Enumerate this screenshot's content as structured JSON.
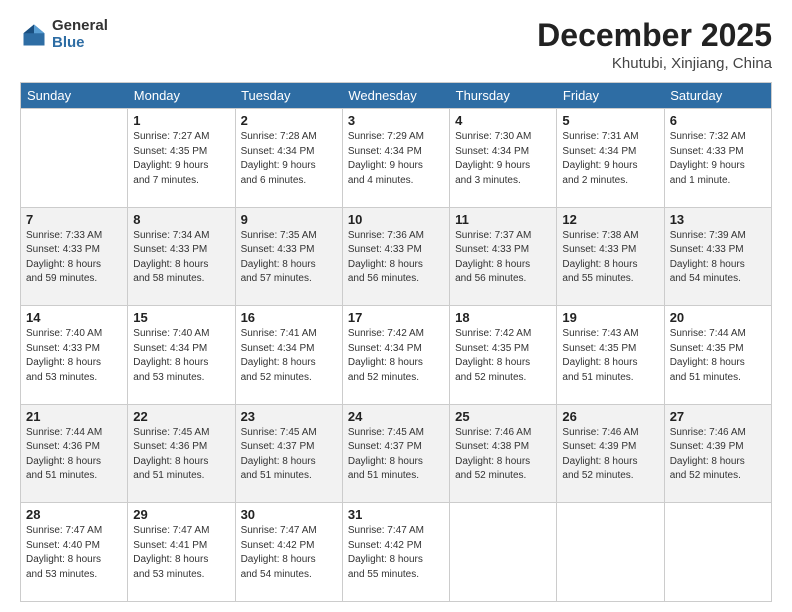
{
  "logo": {
    "general": "General",
    "blue": "Blue"
  },
  "title": {
    "month": "December 2025",
    "location": "Khutubi, Xinjiang, China"
  },
  "days_of_week": [
    "Sunday",
    "Monday",
    "Tuesday",
    "Wednesday",
    "Thursday",
    "Friday",
    "Saturday"
  ],
  "weeks": [
    [
      {
        "day": "",
        "info": ""
      },
      {
        "day": "1",
        "info": "Sunrise: 7:27 AM\nSunset: 4:35 PM\nDaylight: 9 hours\nand 7 minutes."
      },
      {
        "day": "2",
        "info": "Sunrise: 7:28 AM\nSunset: 4:34 PM\nDaylight: 9 hours\nand 6 minutes."
      },
      {
        "day": "3",
        "info": "Sunrise: 7:29 AM\nSunset: 4:34 PM\nDaylight: 9 hours\nand 4 minutes."
      },
      {
        "day": "4",
        "info": "Sunrise: 7:30 AM\nSunset: 4:34 PM\nDaylight: 9 hours\nand 3 minutes."
      },
      {
        "day": "5",
        "info": "Sunrise: 7:31 AM\nSunset: 4:34 PM\nDaylight: 9 hours\nand 2 minutes."
      },
      {
        "day": "6",
        "info": "Sunrise: 7:32 AM\nSunset: 4:33 PM\nDaylight: 9 hours\nand 1 minute."
      }
    ],
    [
      {
        "day": "7",
        "info": "Sunrise: 7:33 AM\nSunset: 4:33 PM\nDaylight: 8 hours\nand 59 minutes."
      },
      {
        "day": "8",
        "info": "Sunrise: 7:34 AM\nSunset: 4:33 PM\nDaylight: 8 hours\nand 58 minutes."
      },
      {
        "day": "9",
        "info": "Sunrise: 7:35 AM\nSunset: 4:33 PM\nDaylight: 8 hours\nand 57 minutes."
      },
      {
        "day": "10",
        "info": "Sunrise: 7:36 AM\nSunset: 4:33 PM\nDaylight: 8 hours\nand 56 minutes."
      },
      {
        "day": "11",
        "info": "Sunrise: 7:37 AM\nSunset: 4:33 PM\nDaylight: 8 hours\nand 56 minutes."
      },
      {
        "day": "12",
        "info": "Sunrise: 7:38 AM\nSunset: 4:33 PM\nDaylight: 8 hours\nand 55 minutes."
      },
      {
        "day": "13",
        "info": "Sunrise: 7:39 AM\nSunset: 4:33 PM\nDaylight: 8 hours\nand 54 minutes."
      }
    ],
    [
      {
        "day": "14",
        "info": "Sunrise: 7:40 AM\nSunset: 4:33 PM\nDaylight: 8 hours\nand 53 minutes."
      },
      {
        "day": "15",
        "info": "Sunrise: 7:40 AM\nSunset: 4:34 PM\nDaylight: 8 hours\nand 53 minutes."
      },
      {
        "day": "16",
        "info": "Sunrise: 7:41 AM\nSunset: 4:34 PM\nDaylight: 8 hours\nand 52 minutes."
      },
      {
        "day": "17",
        "info": "Sunrise: 7:42 AM\nSunset: 4:34 PM\nDaylight: 8 hours\nand 52 minutes."
      },
      {
        "day": "18",
        "info": "Sunrise: 7:42 AM\nSunset: 4:35 PM\nDaylight: 8 hours\nand 52 minutes."
      },
      {
        "day": "19",
        "info": "Sunrise: 7:43 AM\nSunset: 4:35 PM\nDaylight: 8 hours\nand 51 minutes."
      },
      {
        "day": "20",
        "info": "Sunrise: 7:44 AM\nSunset: 4:35 PM\nDaylight: 8 hours\nand 51 minutes."
      }
    ],
    [
      {
        "day": "21",
        "info": "Sunrise: 7:44 AM\nSunset: 4:36 PM\nDaylight: 8 hours\nand 51 minutes."
      },
      {
        "day": "22",
        "info": "Sunrise: 7:45 AM\nSunset: 4:36 PM\nDaylight: 8 hours\nand 51 minutes."
      },
      {
        "day": "23",
        "info": "Sunrise: 7:45 AM\nSunset: 4:37 PM\nDaylight: 8 hours\nand 51 minutes."
      },
      {
        "day": "24",
        "info": "Sunrise: 7:45 AM\nSunset: 4:37 PM\nDaylight: 8 hours\nand 51 minutes."
      },
      {
        "day": "25",
        "info": "Sunrise: 7:46 AM\nSunset: 4:38 PM\nDaylight: 8 hours\nand 52 minutes."
      },
      {
        "day": "26",
        "info": "Sunrise: 7:46 AM\nSunset: 4:39 PM\nDaylight: 8 hours\nand 52 minutes."
      },
      {
        "day": "27",
        "info": "Sunrise: 7:46 AM\nSunset: 4:39 PM\nDaylight: 8 hours\nand 52 minutes."
      }
    ],
    [
      {
        "day": "28",
        "info": "Sunrise: 7:47 AM\nSunset: 4:40 PM\nDaylight: 8 hours\nand 53 minutes."
      },
      {
        "day": "29",
        "info": "Sunrise: 7:47 AM\nSunset: 4:41 PM\nDaylight: 8 hours\nand 53 minutes."
      },
      {
        "day": "30",
        "info": "Sunrise: 7:47 AM\nSunset: 4:42 PM\nDaylight: 8 hours\nand 54 minutes."
      },
      {
        "day": "31",
        "info": "Sunrise: 7:47 AM\nSunset: 4:42 PM\nDaylight: 8 hours\nand 55 minutes."
      },
      {
        "day": "",
        "info": ""
      },
      {
        "day": "",
        "info": ""
      },
      {
        "day": "",
        "info": ""
      }
    ]
  ]
}
